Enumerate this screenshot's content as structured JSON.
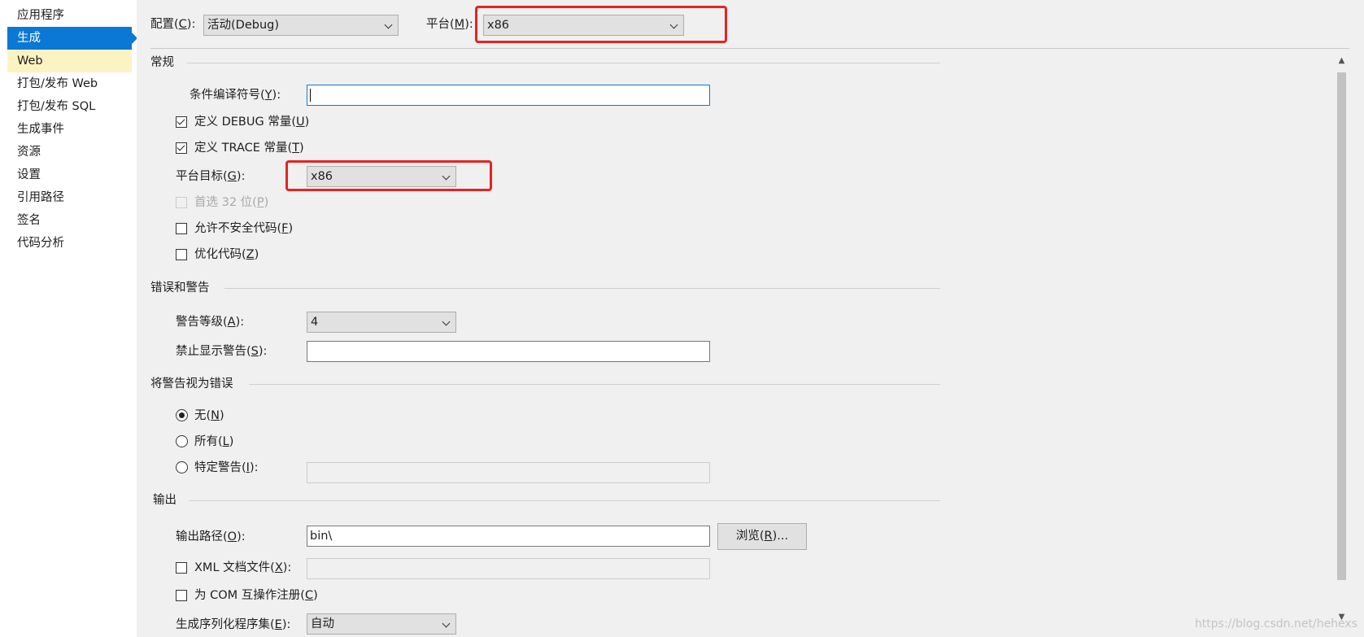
{
  "sidebar": {
    "items": [
      {
        "label": "应用程序"
      },
      {
        "label": "生成"
      },
      {
        "label": "Web"
      },
      {
        "label": "打包/发布 Web"
      },
      {
        "label": "打包/发布 SQL"
      },
      {
        "label": "生成事件"
      },
      {
        "label": "资源"
      },
      {
        "label": "设置"
      },
      {
        "label": "引用路径"
      },
      {
        "label": "签名"
      },
      {
        "label": "代码分析"
      }
    ]
  },
  "header": {
    "config_label": "配置",
    "config_key": "C",
    "config_value": "活动(Debug)",
    "platform_label": "平台",
    "platform_key": "M",
    "platform_value": "x86"
  },
  "general": {
    "title": "常规",
    "conditional_symbols_label": "条件编译符号",
    "conditional_symbols_key": "Y",
    "conditional_symbols_value": "",
    "define_debug_label": "定义 DEBUG 常量",
    "define_debug_key": "U",
    "define_debug_checked": true,
    "define_trace_label": "定义 TRACE 常量",
    "define_trace_key": "T",
    "define_trace_checked": true,
    "platform_target_label": "平台目标",
    "platform_target_key": "G",
    "platform_target_value": "x86",
    "prefer32_label": "首选 32 位",
    "prefer32_key": "P",
    "prefer32_checked": false,
    "unsafe_label": "允许不安全代码",
    "unsafe_key": "F",
    "unsafe_checked": false,
    "optimize_label": "优化代码",
    "optimize_key": "Z",
    "optimize_checked": false
  },
  "errors": {
    "title": "错误和警告",
    "warning_level_label": "警告等级",
    "warning_level_key": "A",
    "warning_level_value": "4",
    "suppress_label": "禁止显示警告",
    "suppress_key": "S",
    "suppress_value": ""
  },
  "treat_as_errors": {
    "title": "将警告视为错误",
    "none_label": "无",
    "none_key": "N",
    "all_label": "所有",
    "all_key": "L",
    "specific_label": "特定警告",
    "specific_key": "I",
    "selected": "none",
    "specific_value": ""
  },
  "output": {
    "title": "输出",
    "path_label": "输出路径",
    "path_key": "O",
    "path_value": "bin\\",
    "browse_label": "浏览",
    "browse_key": "R",
    "browse_suffix": "...",
    "xml_doc_label": "XML 文档文件",
    "xml_doc_key": "X",
    "xml_doc_checked": false,
    "com_label": "为 COM 互操作注册",
    "com_key": "C",
    "com_checked": false,
    "serialization_label": "生成序列化程序集",
    "serialization_key": "E",
    "serialization_value": "自动"
  },
  "watermark": "https://blog.csdn.net/hehexs",
  "colors": {
    "selected_nav": "#0a78d4",
    "hover_nav": "#fcf3c2",
    "highlight_box": "#e8231f",
    "panel_background": "#f0f0f0"
  }
}
